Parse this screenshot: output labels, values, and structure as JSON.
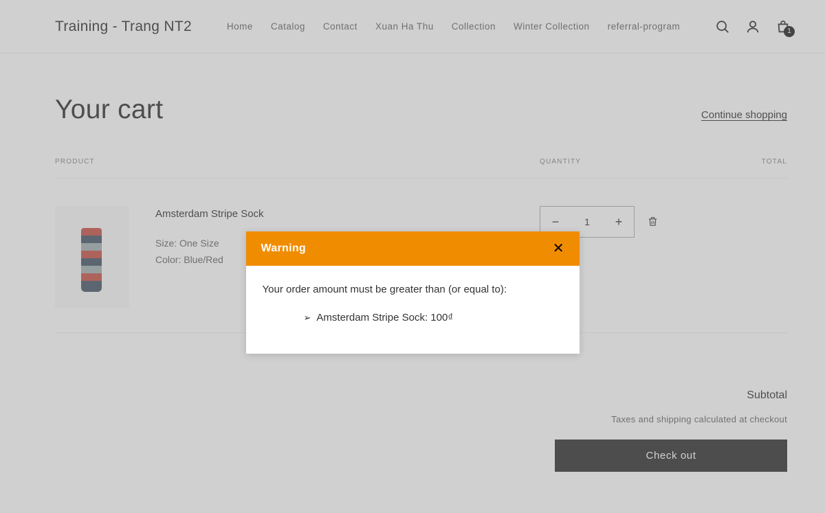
{
  "brand": "Training - Trang NT2",
  "nav": {
    "items": [
      "Home",
      "Catalog",
      "Contact",
      "Xuan Ha Thu",
      "Collection",
      "Winter Collection",
      "referral-program"
    ]
  },
  "cart_count": "1",
  "page": {
    "title": "Your cart",
    "continue_label": "Continue shopping"
  },
  "table": {
    "head_product": "PRODUCT",
    "head_quantity": "QUANTITY",
    "head_total": "TOTAL"
  },
  "item": {
    "name": "Amsterdam Stripe Sock",
    "opt_size": "Size: One Size",
    "opt_color": "Color: Blue/Red",
    "quantity": "1",
    "minus": "−",
    "plus": "+"
  },
  "summary": {
    "subtotal_label": "Subtotal",
    "tax_note": "Taxes and shipping calculated at checkout",
    "checkout_label": "Check out"
  },
  "modal": {
    "title": "Warning",
    "message": "Your order amount must be greater than (or equal to):",
    "item_text": "Amsterdam Stripe Sock: 100₫"
  }
}
